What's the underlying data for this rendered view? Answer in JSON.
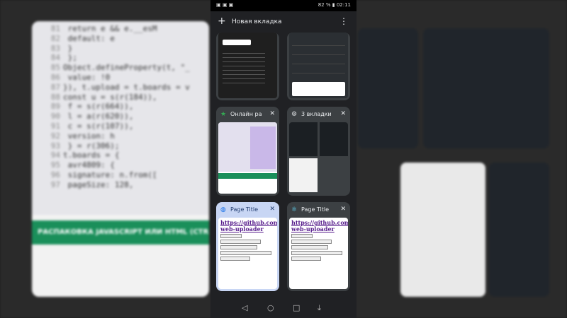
{
  "status_bar": {
    "time": "02:11",
    "battery": "82 %"
  },
  "tab_switcher": {
    "new_tab_label": "Новая вкладка",
    "tabs": [
      {
        "title": "",
        "icon": "code-preview"
      },
      {
        "title": "",
        "icon": "github-article"
      },
      {
        "title": "Онлайн ра",
        "icon": "green-star-icon"
      },
      {
        "title": "3 вкладки",
        "icon": "tab-group-icon"
      },
      {
        "title": "Page Title",
        "icon": "globe-icon",
        "link": "https://github.com/dbo",
        "link2": "web-uploader"
      },
      {
        "title": "Page Title",
        "icon": "react-icon",
        "link": "https://github.com/dbo",
        "link2": "web-uploader"
      }
    ]
  },
  "background": {
    "banner": "РАСПАКОВКА JAVASCRIPT ИЛИ HTML (CTRL",
    "code_lines": [
      {
        "n": "81",
        "t": "    return e && e.__esM"
      },
      {
        "n": "82",
        "t": "      default: e"
      },
      {
        "n": "83",
        "t": "    }"
      },
      {
        "n": "84",
        "t": "  };"
      },
      {
        "n": "85",
        "t": "Object.defineProperty(t, \"_"
      },
      {
        "n": "86",
        "t": "    value: !0"
      },
      {
        "n": "87",
        "t": "}), t.upload = t.boards = v"
      },
      {
        "n": "88",
        "t": "const u = s(r(184)),"
      },
      {
        "n": "89",
        "t": "    f = s(r(664)),"
      },
      {
        "n": "90",
        "t": "    l = a(r(620)),"
      },
      {
        "n": "91",
        "t": "    c = s(r(107)),"
      },
      {
        "n": "92",
        "t": "      version: h"
      },
      {
        "n": "93",
        "t": "    } = r(306);"
      },
      {
        "n": "94",
        "t": "t.boards = {"
      },
      {
        "n": "95",
        "t": "    avr4809: {"
      },
      {
        "n": "96",
        "t": "      signature: n.from(["
      },
      {
        "n": "97",
        "t": "      pageSize: 128,"
      }
    ]
  }
}
